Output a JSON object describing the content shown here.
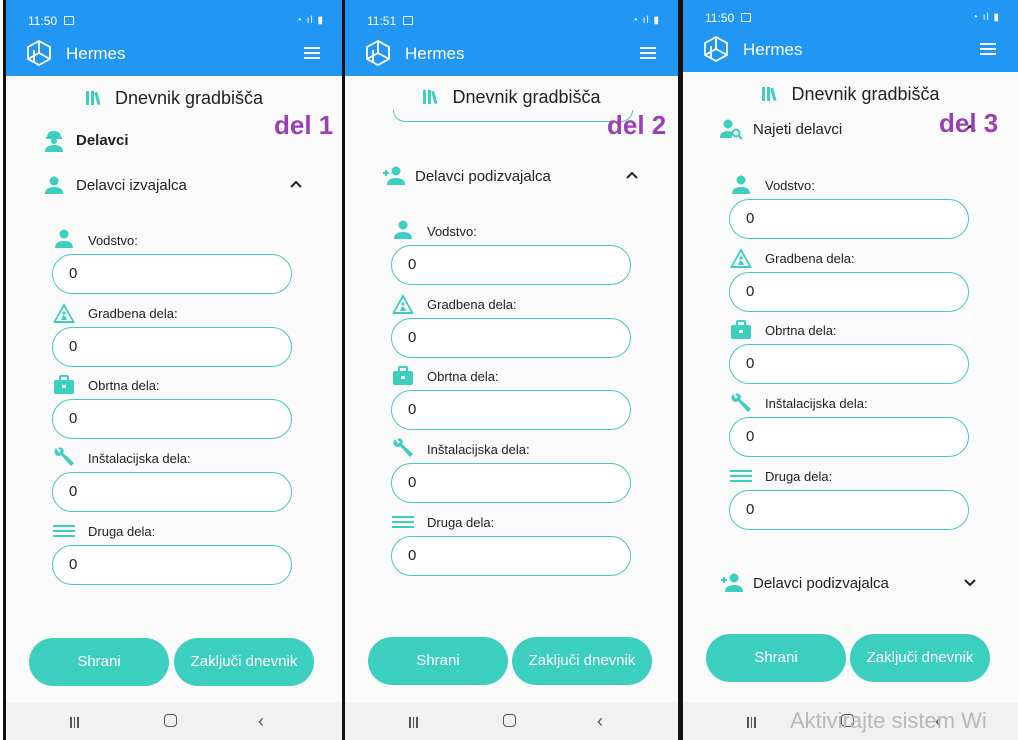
{
  "app": {
    "name": "Hermes"
  },
  "screens": [
    {
      "time": "11:50",
      "heading": "Dnevnik gradbišča",
      "part_label": "del 1",
      "category": "Delavci",
      "section": "Delavci izvajalca",
      "fields": [
        {
          "label": "Vodstvo:",
          "value": "0"
        },
        {
          "label": "Gradbena dela:",
          "value": "0"
        },
        {
          "label": "Obrtna dela:",
          "value": "0"
        },
        {
          "label": "Inštalacijska dela:",
          "value": "0"
        },
        {
          "label": "Druga dela:",
          "value": "0"
        }
      ],
      "buttons": {
        "save": "Shrani",
        "close": "Zaključi dnevnik"
      }
    },
    {
      "time": "11:51",
      "heading": "Dnevnik gradbišča",
      "part_label": "del 2",
      "section": "Delavci podizvajalca",
      "fields": [
        {
          "label": "Vodstvo:",
          "value": "0"
        },
        {
          "label": "Gradbena dela:",
          "value": "0"
        },
        {
          "label": "Obrtna dela:",
          "value": "0"
        },
        {
          "label": "Inštalacijska dela:",
          "value": "0"
        },
        {
          "label": "Druga dela:",
          "value": "0"
        }
      ],
      "buttons": {
        "save": "Shrani",
        "close": "Zaključi dnevnik"
      }
    },
    {
      "time": "11:50",
      "heading": "Dnevnik gradbišča",
      "part_label": "del 3",
      "section": "Najeti delavci",
      "fields": [
        {
          "label": "Vodstvo:",
          "value": "0"
        },
        {
          "label": "Gradbena dela:",
          "value": "0"
        },
        {
          "label": "Obrtna dela:",
          "value": "0"
        },
        {
          "label": "Inštalacijska dela:",
          "value": "0"
        },
        {
          "label": "Druga dela:",
          "value": "0"
        }
      ],
      "section_collapsed": "Delavci podizvajalca",
      "buttons": {
        "save": "Shrani",
        "close": "Zaključi dnevnik"
      }
    }
  ],
  "watermark": "Aktivirajte sistem Wi",
  "icons": {
    "logo": "cube-logo-icon",
    "menu": "hamburger-menu-icon",
    "book": "books-icon",
    "worker": "construction-worker-icon",
    "person": "person-icon",
    "add_person": "person-add-icon",
    "search_person": "person-search-icon",
    "warning": "construction-warning-icon",
    "briefcase": "briefcase-icon",
    "wrench": "wrench-icon",
    "lines": "lines-icon"
  },
  "colors": {
    "primary": "#2196f3",
    "accent": "#3ccfc0",
    "tag": "#9b3fb5"
  }
}
